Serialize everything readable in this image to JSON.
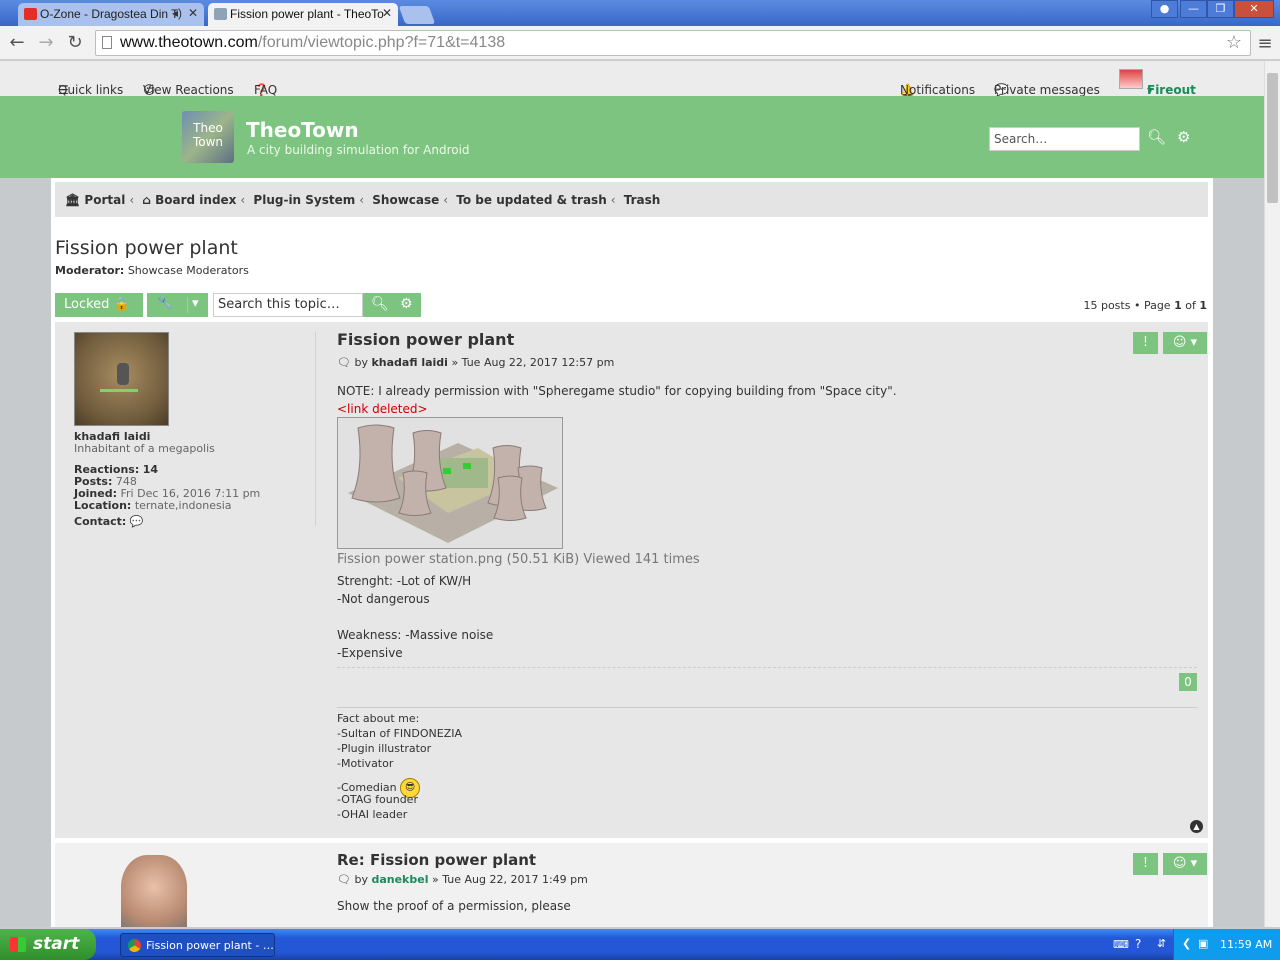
{
  "browser": {
    "tabs": [
      {
        "title": "O-Zone - Dragostea Din T",
        "active": false
      },
      {
        "title": "Fission power plant - TheoTo",
        "active": true
      }
    ],
    "url_host": "www.theotown.com",
    "url_path": "/forum/viewtopic.php?f=71&t=4138"
  },
  "topnav": {
    "quick_links": "Quick links",
    "view_reactions": "View Reactions",
    "faq": "FAQ",
    "notifications": "Notifications",
    "private_messages": "Private messages",
    "username": "Fireout"
  },
  "site": {
    "logo_text": "Theo Town",
    "name": "TheoTown",
    "description": "A city building simulation for Android",
    "search_placeholder": "Search…"
  },
  "breadcrumbs": [
    "Portal",
    "Board index",
    "Plug-in System",
    "Showcase",
    "To be updated & trash",
    "Trash"
  ],
  "topic": {
    "title": "Fission power plant",
    "moderator_label": "Moderator:",
    "moderator_value": "Showcase Moderators",
    "locked_label": "Locked",
    "search_placeholder": "Search this topic…",
    "pagination": {
      "posts": "15 posts",
      "page_word": "Page",
      "current": "1",
      "of_word": "of",
      "total": "1"
    }
  },
  "posts": [
    {
      "title": "Fission power plant",
      "by": "by",
      "author": "khadafi laidi",
      "date": "» Tue Aug 22, 2017 12:57 pm",
      "user": {
        "name": "khadafi laidi",
        "rank": "Inhabitant of a megapolis",
        "reactions_label": "Reactions:",
        "reactions": "14",
        "posts_label": "Posts:",
        "posts": "748",
        "joined_label": "Joined:",
        "joined": "Fri Dec 16, 2016 7:11 pm",
        "location_label": "Location:",
        "location": "ternate,indonesia",
        "contact_label": "Contact:"
      },
      "body": {
        "note": "NOTE: I already permission with \"Spheregame studio\" for copying building from \"Space city\".",
        "link_deleted": "<link deleted>",
        "attachment_caption": "Fission power station.png (50.51 KiB) Viewed 141 times",
        "lines": [
          "Strenght: -Lot of KW/H",
          "-Not dangerous",
          "",
          "Weakness: -Massive noise",
          "-Expensive"
        ]
      },
      "reaction_count": "0",
      "signature": [
        "Fact about me:",
        "-Sultan of FINDONEZIA",
        "-Plugin illustrator",
        "-Motivator",
        "-Comedian",
        "-OTAG founder",
        "-OHAI leader"
      ]
    },
    {
      "title": "Re: Fission power plant",
      "by": "by",
      "author": "danekbel",
      "date": "» Tue Aug 22, 2017 1:49 pm",
      "body_first_line": "Show the proof of a permission, please"
    }
  ],
  "taskbar": {
    "start": "start",
    "item": "Fission power plant - …",
    "clock": "11:59 AM"
  },
  "colors": {
    "accent_green": "#7cc47f",
    "link_deleted": "#cc0000",
    "author_link": "#105289"
  }
}
